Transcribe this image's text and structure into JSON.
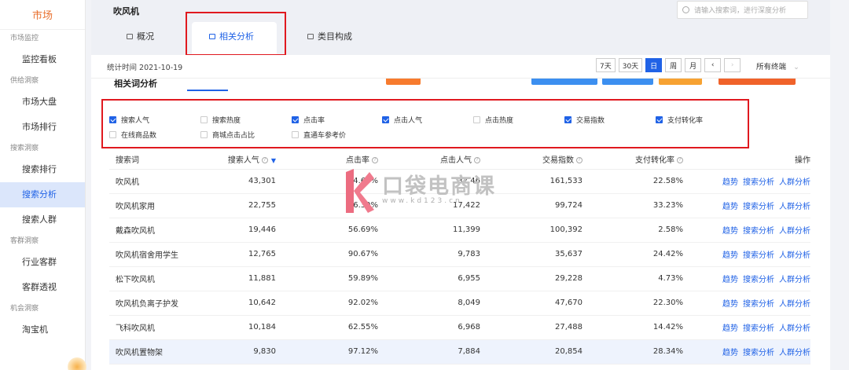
{
  "sidebar": {
    "logo": "市场",
    "sections": [
      {
        "title": "市场监控",
        "items": [
          "监控看板"
        ]
      },
      {
        "title": "供给洞察",
        "items": [
          "市场大盘",
          "市场排行"
        ]
      },
      {
        "title": "搜索洞察",
        "items": [
          "搜索排行",
          "搜索分析",
          "搜索人群"
        ]
      },
      {
        "title": "客群洞察",
        "items": [
          "行业客群",
          "客群透视"
        ]
      },
      {
        "title": "机会洞察",
        "items": [
          "淘宝机"
        ]
      }
    ],
    "active_item": "搜索分析"
  },
  "header": {
    "title": "吹风机",
    "search_placeholder": "请输入搜索词，进行深度分析",
    "tabs": [
      "概况",
      "相关分析",
      "类目构成"
    ],
    "active_tab": "相关分析"
  },
  "stats": {
    "date_label": "统计时间 2021-10-19",
    "ranges": [
      "7天",
      "30天",
      "日",
      "周",
      "月"
    ],
    "active_range": "日",
    "terminal": "所有终端"
  },
  "section": {
    "title": "相关词分析"
  },
  "metrics": [
    {
      "label": "搜索人气",
      "checked": true
    },
    {
      "label": "搜索热度",
      "checked": false
    },
    {
      "label": "点击率",
      "checked": true
    },
    {
      "label": "点击人气",
      "checked": true
    },
    {
      "label": "点击热度",
      "checked": false
    },
    {
      "label": "交易指数",
      "checked": true
    },
    {
      "label": "支付转化率",
      "checked": true
    },
    {
      "label": "在线商品数",
      "checked": false
    },
    {
      "label": "商城点击占比",
      "checked": false
    },
    {
      "label": "直通车参考价",
      "checked": false
    }
  ],
  "table": {
    "columns": [
      "搜索词",
      "搜索人气",
      "点击率",
      "点击人气",
      "交易指数",
      "支付转化率",
      "操作"
    ],
    "actions": [
      "趋势",
      "搜索分析",
      "人群分析"
    ],
    "rows": [
      [
        "吹风机",
        "43,301",
        "84.69%",
        "32,46",
        "161,533",
        "22.58%"
      ],
      [
        "吹风机家用",
        "22,755",
        "86.39%",
        "17,422",
        "99,724",
        "33.23%"
      ],
      [
        "戴森吹风机",
        "19,446",
        "56.69%",
        "11,399",
        "100,392",
        "2.58%"
      ],
      [
        "吹风机宿舍用学生",
        "12,765",
        "90.67%",
        "9,783",
        "35,637",
        "24.42%"
      ],
      [
        "松下吹风机",
        "11,881",
        "59.89%",
        "6,955",
        "29,228",
        "4.73%"
      ],
      [
        "吹风机负离子护发",
        "10,642",
        "92.02%",
        "8,049",
        "47,670",
        "22.30%"
      ],
      [
        "飞科吹风机",
        "10,184",
        "62.55%",
        "6,968",
        "27,488",
        "14.42%"
      ],
      [
        "吹风机置物架",
        "9,830",
        "97.12%",
        "7,884",
        "20,854",
        "28.34%"
      ]
    ]
  },
  "watermark": {
    "text": "口袋电商课",
    "url": "www.kd123.cn"
  }
}
